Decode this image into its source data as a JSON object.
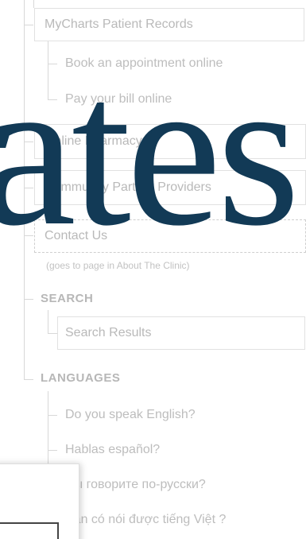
{
  "nav": {
    "mycharts": "MyCharts Patient Records",
    "book": "Book an appointment online",
    "pay": "Pay your bill online",
    "pharmacy": "Online Pharmacy",
    "partners": "Community Partner Providers",
    "contact": "Contact Us",
    "contact_note": "(goes to page in About The Clinic)"
  },
  "search": {
    "heading": "SEARCH",
    "results": "Search Results"
  },
  "languages": {
    "heading": "LANGUAGES",
    "items": [
      "Do you speak English?",
      "Hablas español?",
      "Вы говорите по-русски?",
      "Bạn có nói được tiếng Việt ?"
    ]
  },
  "overlay": {
    "text": "ates",
    "color": "#123a56"
  }
}
